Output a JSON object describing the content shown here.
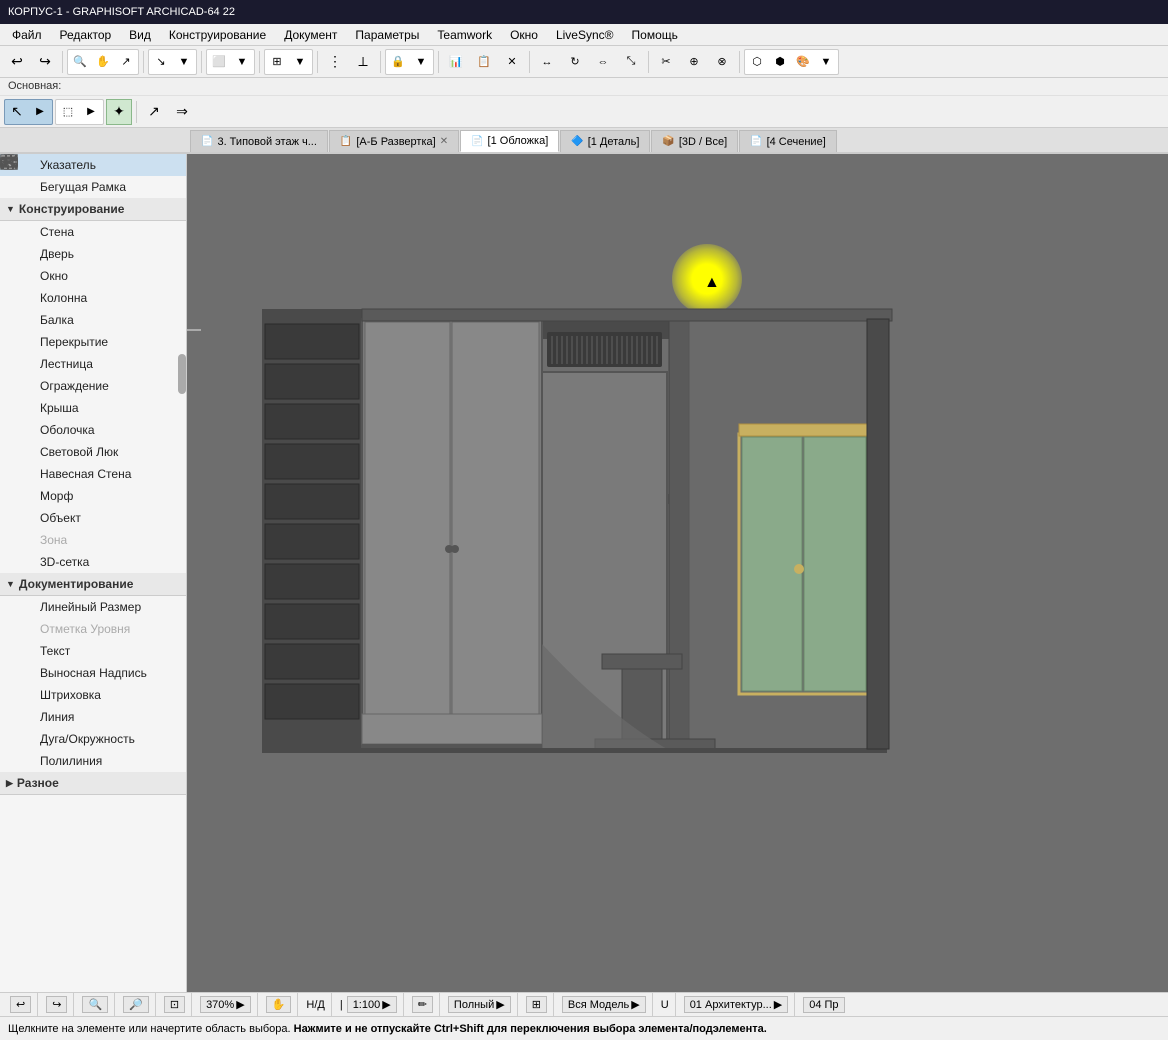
{
  "title_bar": {
    "text": "КОРПУС-1 - GRAPHISOFT ARCHICAD-64 22"
  },
  "menu": {
    "items": [
      "Файл",
      "Редактор",
      "Вид",
      "Конструирование",
      "Документ",
      "Параметры",
      "Teamwork",
      "Окно",
      "LiveSync®",
      "Помощь"
    ]
  },
  "toolbar_label": "Основная:",
  "tabs": [
    {
      "id": "tab1",
      "icon": "📄",
      "label": "3. Типовой этаж ч...",
      "active": false,
      "closable": false
    },
    {
      "id": "tab2",
      "icon": "📋",
      "label": "[А-Б Развертка]",
      "active": false,
      "closable": true
    },
    {
      "id": "tab3",
      "icon": "📄",
      "label": "[1 Обложка]",
      "active": true,
      "closable": false
    },
    {
      "id": "tab4",
      "icon": "🔷",
      "label": "[1 Деталь]",
      "active": false,
      "closable": false
    },
    {
      "id": "tab5",
      "icon": "📦",
      "label": "[3D / Все]",
      "active": false,
      "closable": false
    },
    {
      "id": "tab6",
      "icon": "📄",
      "label": "[4 Сечение]",
      "active": false,
      "closable": false
    }
  ],
  "sidebar": {
    "pointer_label": "Указатель",
    "running_frame_label": "Бегущая Рамка",
    "section_construction": "Конструирование",
    "items_construction": [
      {
        "id": "wall",
        "label": "Стена",
        "disabled": false
      },
      {
        "id": "door",
        "label": "Дверь",
        "disabled": false
      },
      {
        "id": "window",
        "label": "Окно",
        "disabled": false
      },
      {
        "id": "column",
        "label": "Колонна",
        "disabled": false
      },
      {
        "id": "beam",
        "label": "Балка",
        "disabled": false
      },
      {
        "id": "slab",
        "label": "Перекрытие",
        "disabled": false
      },
      {
        "id": "stair",
        "label": "Лестница",
        "disabled": false
      },
      {
        "id": "railing",
        "label": "Ограждение",
        "disabled": false
      },
      {
        "id": "roof",
        "label": "Крыша",
        "disabled": false
      },
      {
        "id": "shell",
        "label": "Оболочка",
        "disabled": false
      },
      {
        "id": "skylight",
        "label": "Световой Люк",
        "disabled": false
      },
      {
        "id": "curtain",
        "label": "Навесная Стена",
        "disabled": false
      },
      {
        "id": "morph",
        "label": "Морф",
        "disabled": false
      },
      {
        "id": "object",
        "label": "Объект",
        "disabled": false
      },
      {
        "id": "zone",
        "label": "Зона",
        "disabled": true
      },
      {
        "id": "mesh",
        "label": "3D-сетка",
        "disabled": false
      }
    ],
    "section_docs": "Документирование",
    "items_docs": [
      {
        "id": "dim",
        "label": "Линейный Размер",
        "disabled": false
      },
      {
        "id": "level",
        "label": "Отметка Уровня",
        "disabled": true
      },
      {
        "id": "text",
        "label": "Текст",
        "disabled": false
      },
      {
        "id": "label",
        "label": "Выносная Надпись",
        "disabled": false
      },
      {
        "id": "hatch",
        "label": "Штриховка",
        "disabled": false
      },
      {
        "id": "line",
        "label": "Линия",
        "disabled": false
      },
      {
        "id": "arc",
        "label": "Дуга/Окружность",
        "disabled": false
      },
      {
        "id": "polyline",
        "label": "Полилиния",
        "disabled": false
      }
    ],
    "section_misc": "Разное"
  },
  "status_bar": {
    "undo_icon": "↩",
    "redo_icon": "↪",
    "zoom_decrease": "🔍",
    "zoom_increase": "🔎",
    "zoom_fit": "⊡",
    "zoom_value": "370%",
    "zoom_arrow": "▶",
    "pan_icon": "✋",
    "scale_value": "1:100",
    "scale_arrow": "▶",
    "pen_icon": "✏",
    "view_mode": "Полный",
    "view_arrow": "▶",
    "grid_icon": "⊞",
    "model_scope": "Вся Модель",
    "model_arrow": "▶",
    "u_icon": "U",
    "layer": "01 Архитектур...",
    "layer_arrow": "▶",
    "extra": "04 Пр"
  },
  "hint_bar": {
    "part1": "Щелкните на элементе или начертите область выбора.",
    "part2": "Нажмите и не отпускайте Ctrl+Shift для переключения выбора элемента/подэлемента."
  }
}
